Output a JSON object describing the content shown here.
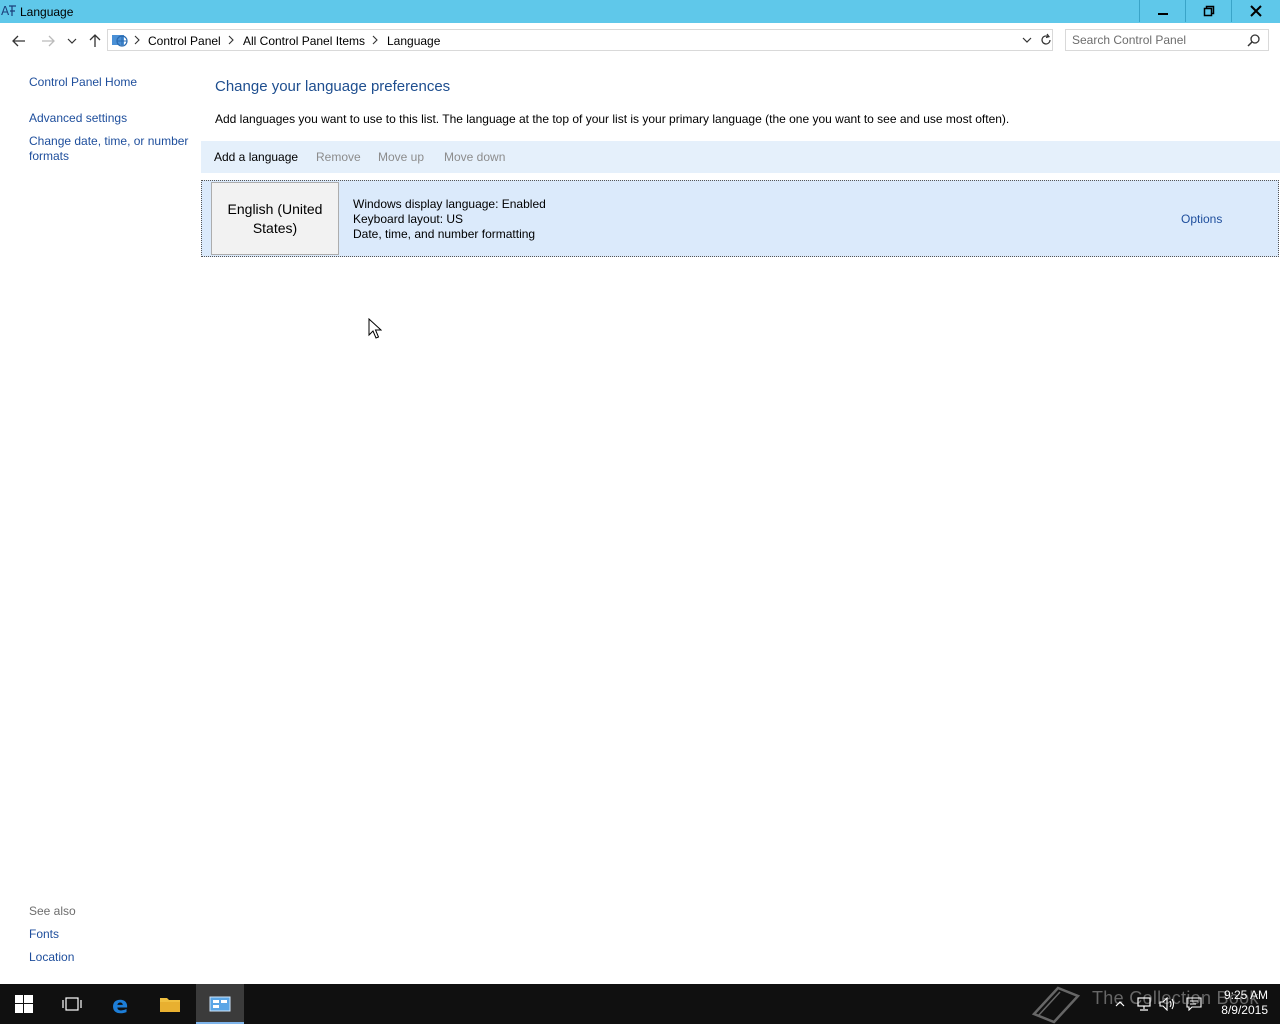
{
  "window": {
    "title": "Language"
  },
  "address_bar": {
    "crumbs": [
      "Control Panel",
      "All Control Panel Items",
      "Language"
    ],
    "search_placeholder": "Search Control Panel"
  },
  "left_nav": {
    "home": "Control Panel Home",
    "items": [
      "Advanced settings",
      "Change date, time, or number",
      "formats"
    ],
    "see_also_heading": "See also",
    "see_also_items": [
      "Fonts",
      "Location"
    ]
  },
  "main": {
    "title": "Change your language preferences",
    "description": "Add languages you want to use to this list. The language at the top of your list is your primary language (the one you want to see and use most often).",
    "toolbar": {
      "add": "Add a language",
      "remove": "Remove",
      "move_up": "Move up",
      "move_down": "Move down"
    },
    "languages": [
      {
        "name_line1": "English (United",
        "name_line2": "States)",
        "info": [
          "Windows display language: Enabled",
          "Keyboard layout: US",
          "Date, time, and number formatting"
        ],
        "options_label": "Options"
      }
    ]
  },
  "taskbar": {
    "time": "9:25 AM",
    "date": "8/9/2015",
    "watermark": "The Collection Book"
  },
  "colors": {
    "titlebar": "#5fc8ea",
    "link": "#1e4e9c",
    "toolbar_bg": "#e5f0fb",
    "row_bg": "#dbeafb",
    "taskbar": "#101010"
  }
}
